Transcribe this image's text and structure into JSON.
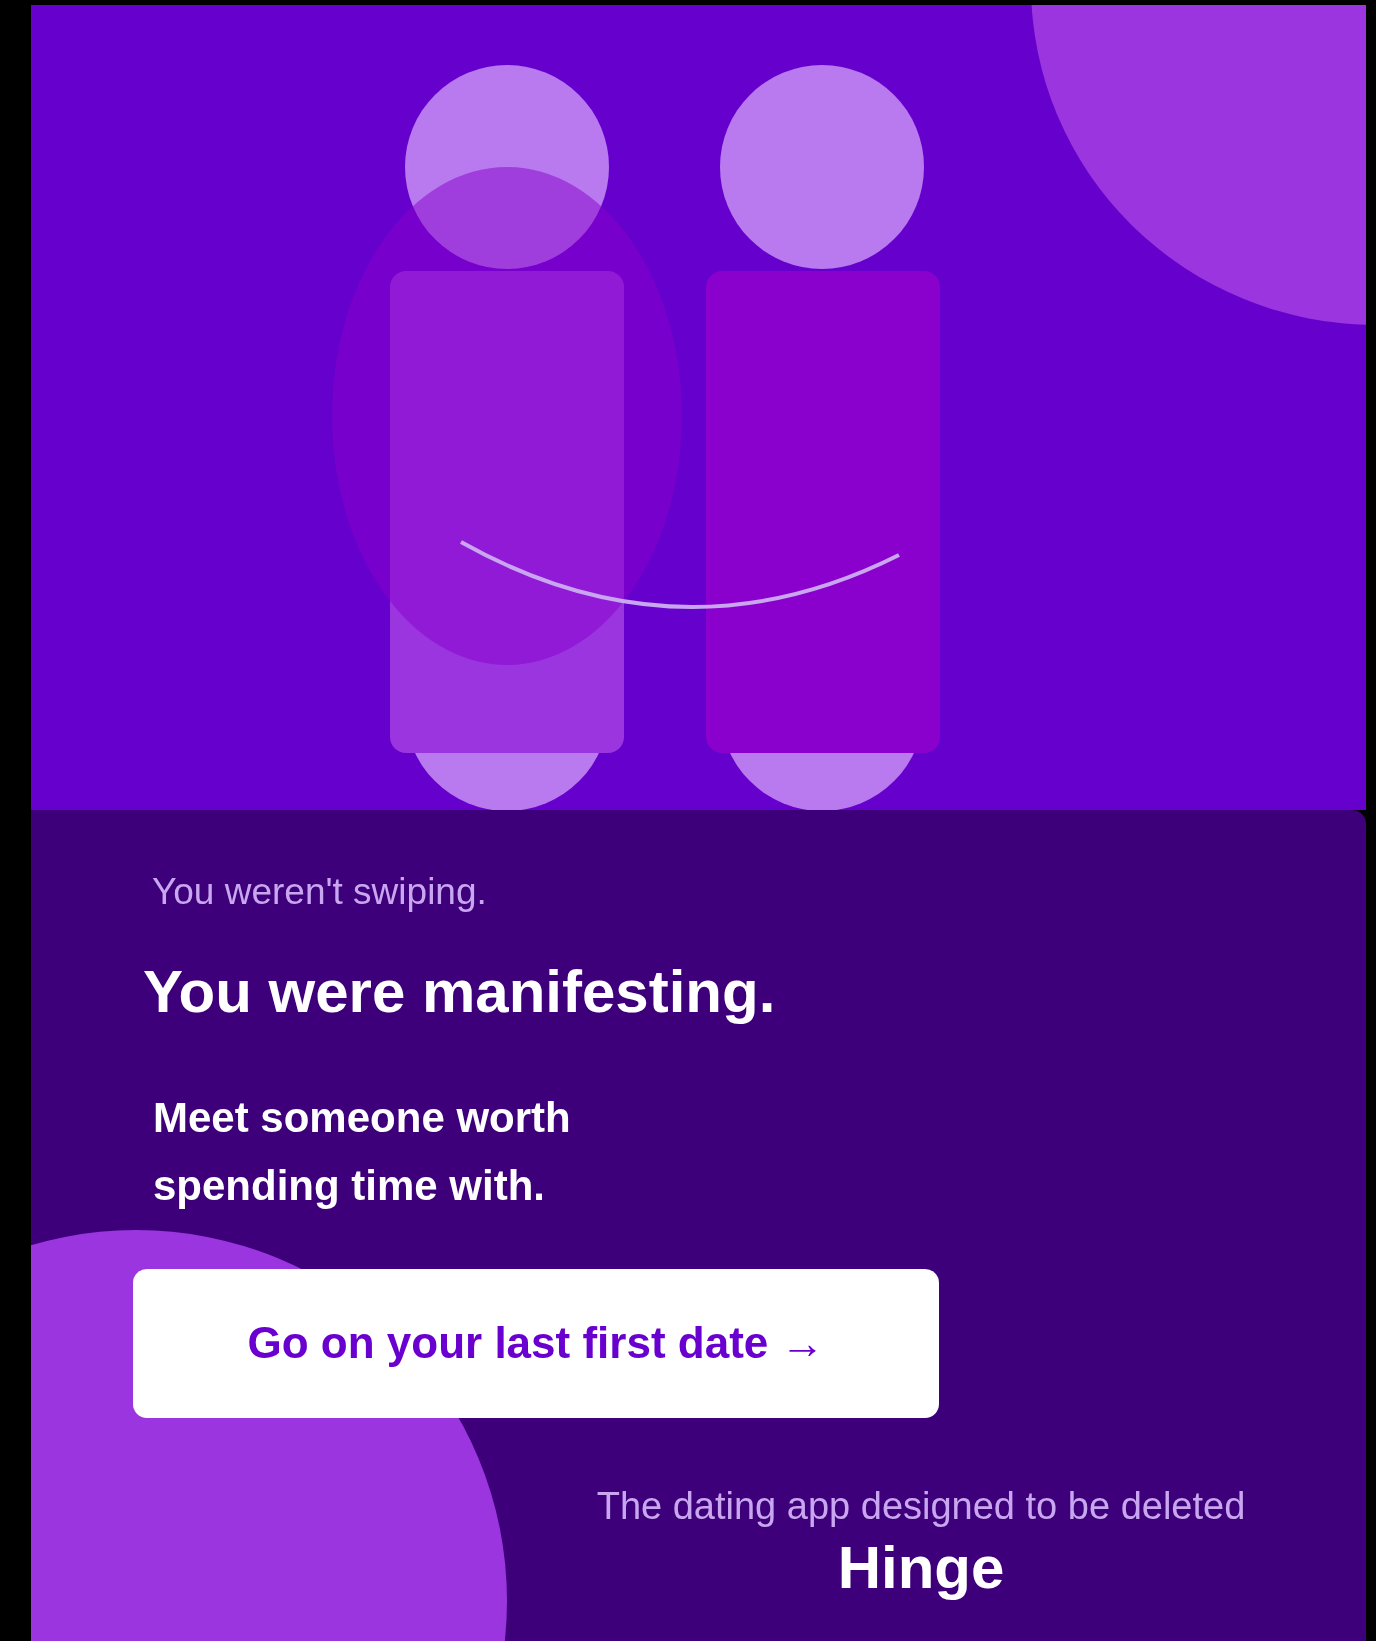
{
  "intro": "You weren't swiping.",
  "headline": "You were manifesting.",
  "subheadline": "Meet someone worth\nspending time with.",
  "cta_button": {
    "label": "Go on your last first date →"
  },
  "tagline": "The dating app designed to be deleted",
  "brand": "Hinge"
}
